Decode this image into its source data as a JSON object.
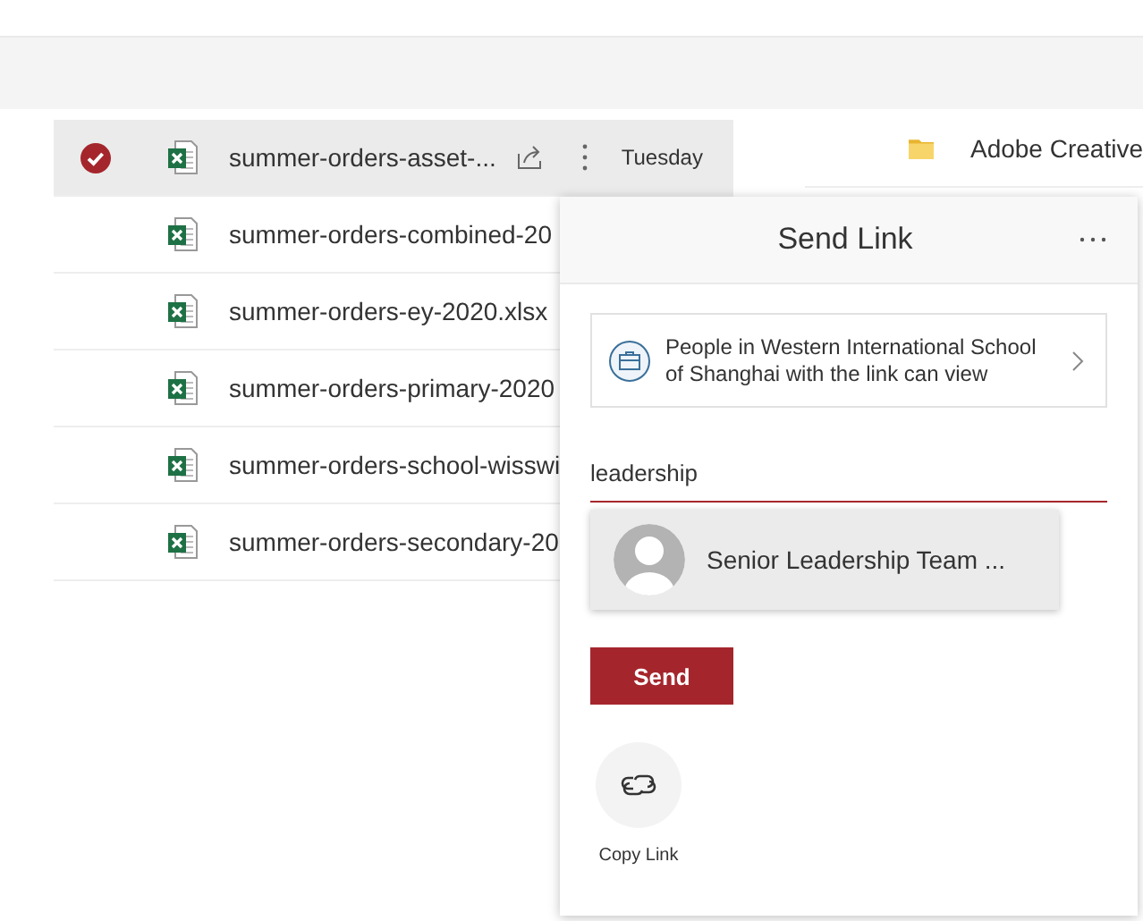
{
  "files": [
    {
      "name": "summer-orders-asset-...",
      "selected": true,
      "modified": "Tuesday"
    },
    {
      "name": "summer-orders-combined-20",
      "selected": false
    },
    {
      "name": "summer-orders-ey-2020.xlsx",
      "selected": false
    },
    {
      "name": "summer-orders-primary-2020",
      "selected": false
    },
    {
      "name": "summer-orders-school-wisswi",
      "selected": false
    },
    {
      "name": "summer-orders-secondary-20",
      "selected": false
    }
  ],
  "folders": [
    {
      "kind": "folder",
      "name": "Adobe Creative"
    }
  ],
  "send_link": {
    "title": "Send Link",
    "scope": "People in Western International School of Shanghai with the link can view",
    "recipient": {
      "value": "leadership"
    },
    "suggestions": [
      {
        "name": "Senior Leadership Team ..."
      }
    ],
    "send_button": "Send",
    "copy_link": "Copy Link"
  }
}
